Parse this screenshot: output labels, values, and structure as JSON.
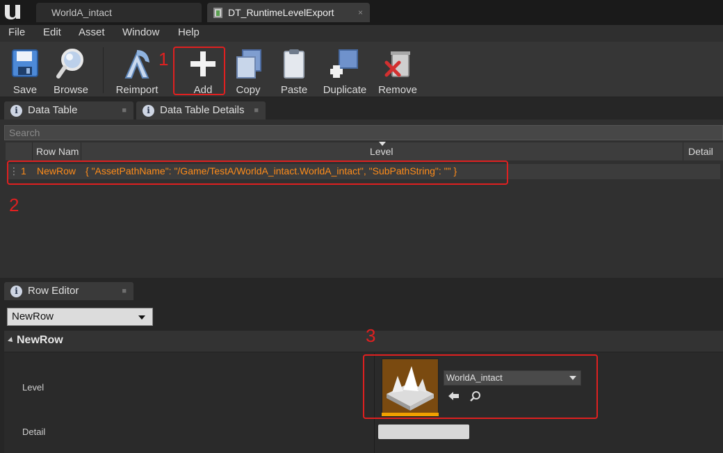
{
  "tabs": {
    "world_tab": "WorldA_intact",
    "dt_tab": "DT_RuntimeLevelExport",
    "close_glyph": "×"
  },
  "menu": [
    "File",
    "Edit",
    "Asset",
    "Window",
    "Help"
  ],
  "toolbar": {
    "save": "Save",
    "browse": "Browse",
    "reimport": "Reimport",
    "add": "Add",
    "copy": "Copy",
    "paste": "Paste",
    "duplicate": "Duplicate",
    "remove": "Remove"
  },
  "panels": {
    "data_table": "Data Table",
    "data_table_details": "Data Table Details",
    "row_editor": "Row Editor"
  },
  "search": {
    "placeholder": "Search"
  },
  "table": {
    "columns": [
      "Row Nam",
      "Level",
      "Detail"
    ],
    "rows": [
      {
        "index": "1",
        "name": "NewRow",
        "value": "{ \"AssetPathName\": \"/Game/TestA/WorldA_intact.WorldA_intact\", \"SubPathString\": \"\" }"
      }
    ]
  },
  "row_editor": {
    "selected_row": "NewRow",
    "section_title": "NewRow",
    "props": {
      "level_label": "Level",
      "detail_label": "Detail",
      "level_value": "WorldA_intact"
    }
  },
  "annotations": {
    "one": "1",
    "two": "2",
    "three": "3"
  },
  "colors": {
    "highlight": "#e02020",
    "row_text": "#ff8c1a"
  }
}
